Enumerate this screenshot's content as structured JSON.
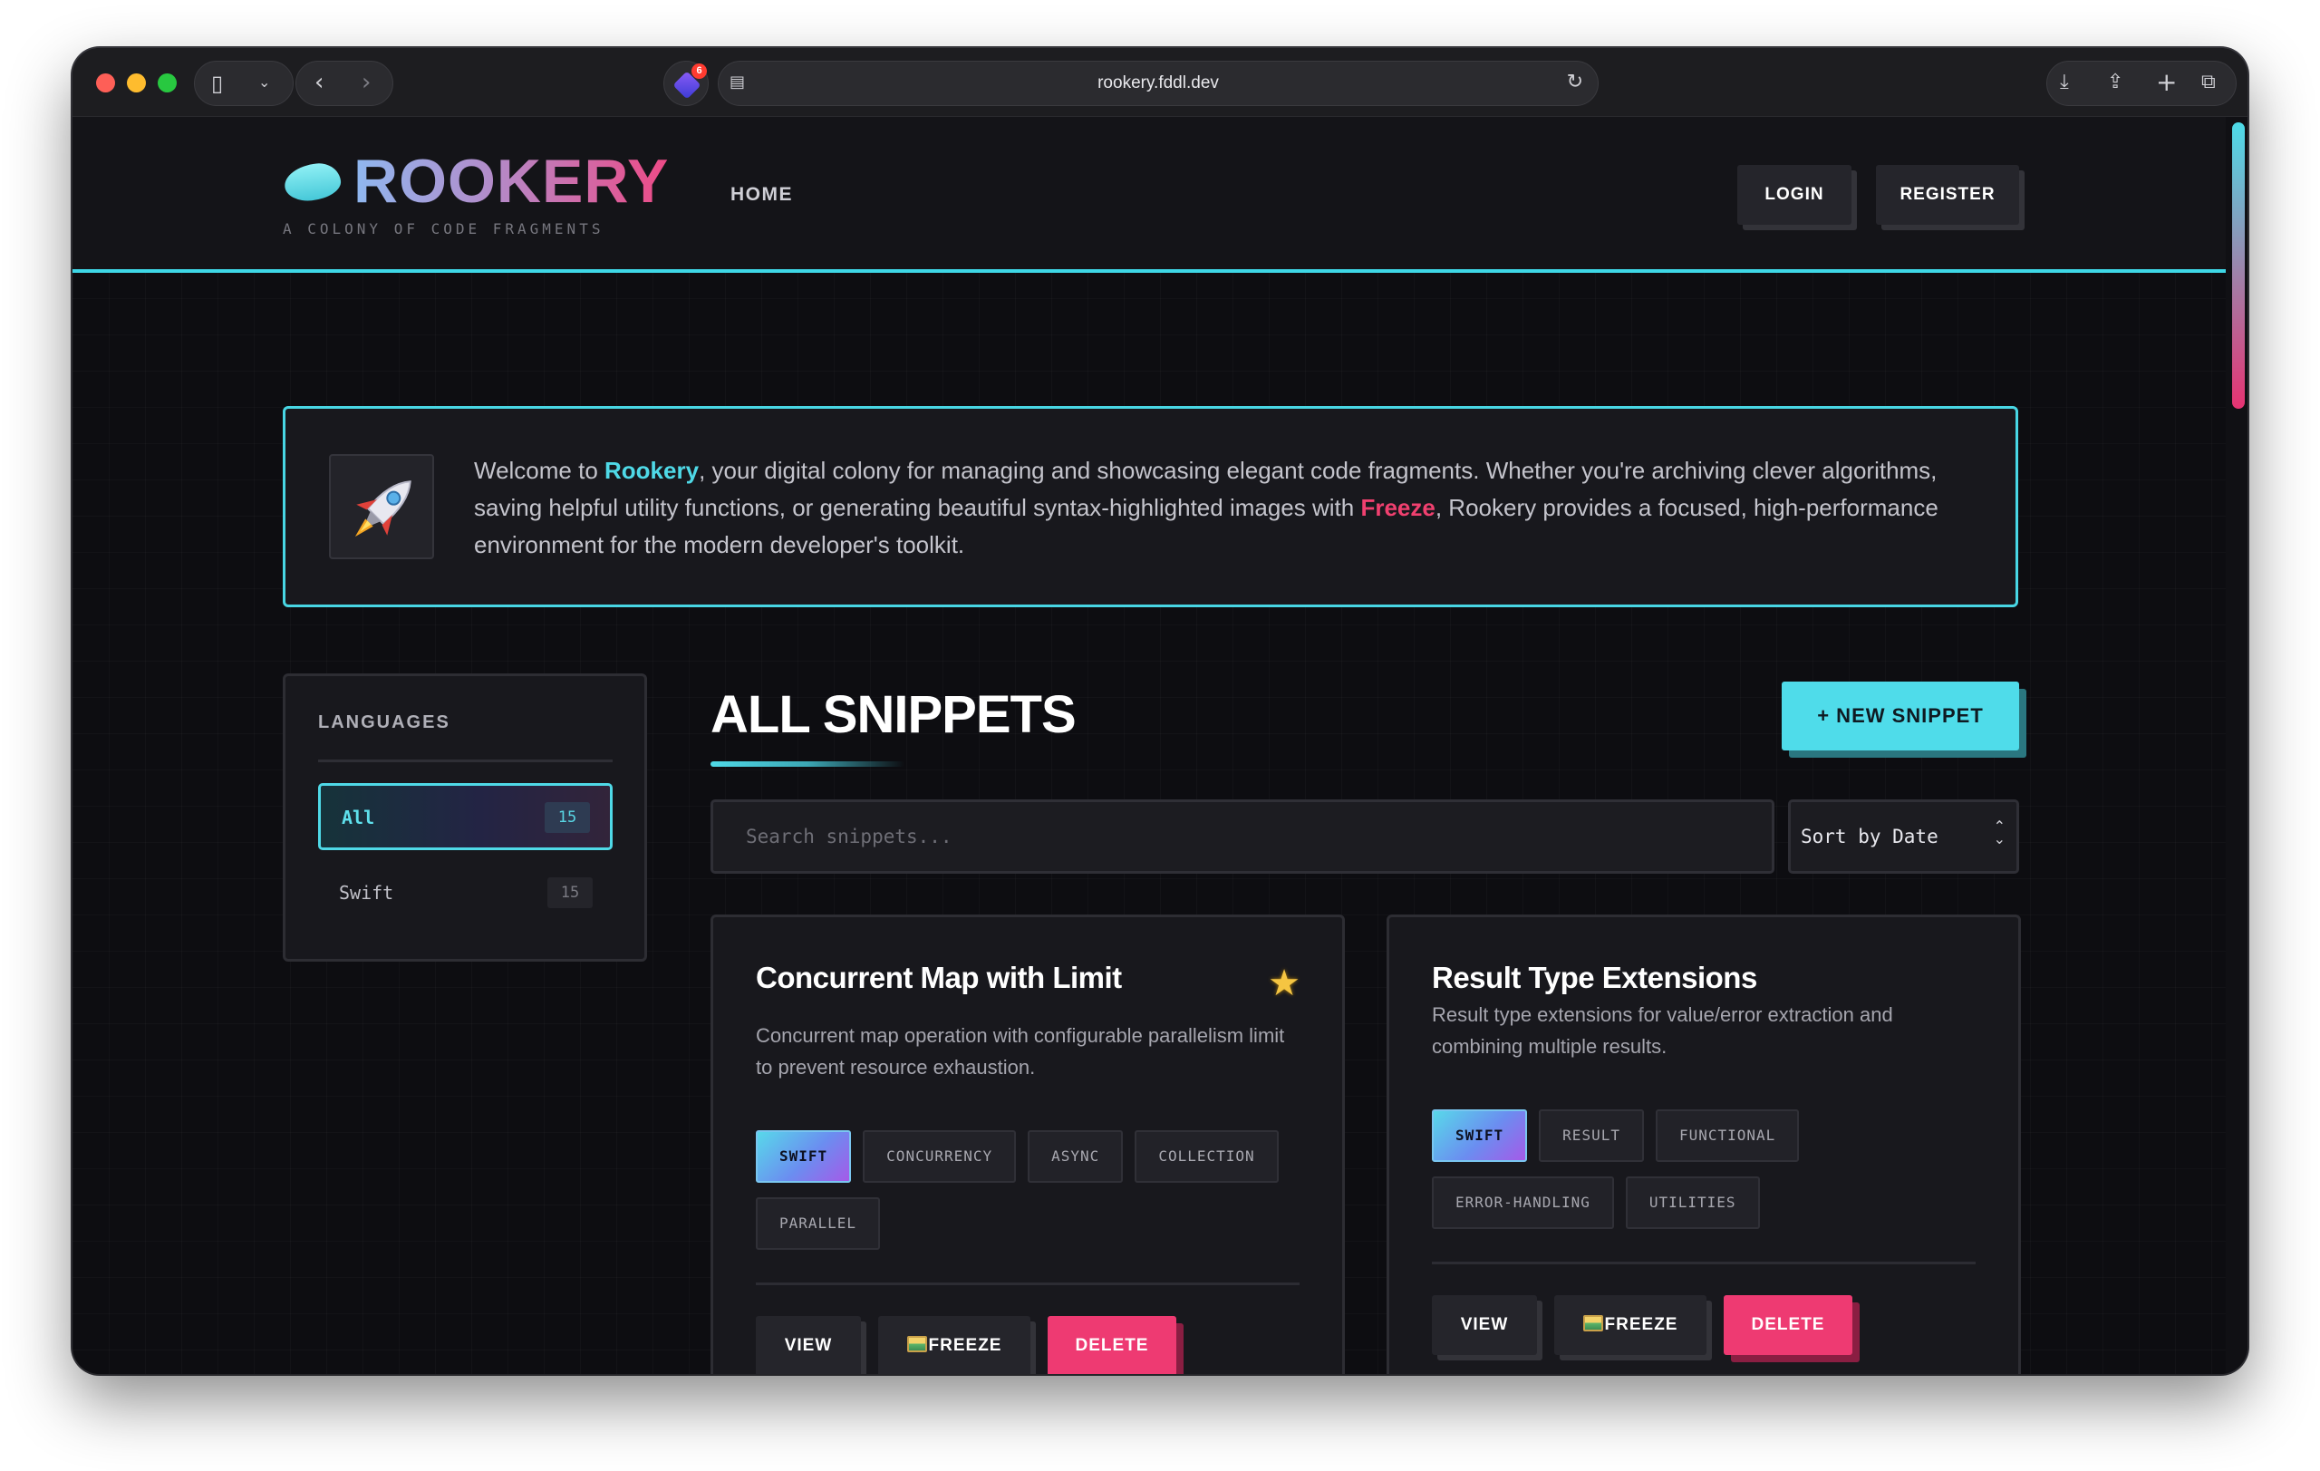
{
  "browser": {
    "url": "rookery.fddl.dev",
    "extension_badge_count": "6"
  },
  "header": {
    "logo_text": "ROOKERY",
    "tagline": "A COLONY OF CODE FRAGMENTS",
    "nav_home": "HOME",
    "login_label": "LOGIN",
    "register_label": "REGISTER"
  },
  "banner": {
    "icon": "rocket-icon",
    "text_1": "Welcome to ",
    "brand": "Rookery",
    "text_2": ", your digital colony for managing and showcasing elegant code fragments. Whether you're archiving clever algorithms, saving helpful utility functions, or generating beautiful syntax-highlighted images with ",
    "freeze": "Freeze",
    "text_3": ", Rookery provides a focused, high-performance environment for the modern developer's toolkit."
  },
  "sidebar": {
    "title": "LANGUAGES",
    "items": [
      {
        "label": "All",
        "count": "15",
        "active": true
      },
      {
        "label": "Swift",
        "count": "15",
        "active": false
      }
    ]
  },
  "main": {
    "title": "ALL SNIPPETS",
    "new_button": "+ NEW SNIPPET",
    "search_placeholder": "Search snippets...",
    "sort_label": "Sort by Date"
  },
  "cards": [
    {
      "title": "Concurrent Map with Limit",
      "starred": true,
      "description": "Concurrent map operation with configurable parallelism limit to prevent resource exhaustion.",
      "tags": [
        "SWIFT",
        "CONCURRENCY",
        "ASYNC",
        "COLLECTION",
        "PARALLEL"
      ],
      "view_label": "VIEW",
      "freeze_label": "FREEZE",
      "delete_label": "DELETE"
    },
    {
      "title": "Result Type Extensions",
      "starred": false,
      "description": "Result type extensions for value/error extraction and combining multiple results.",
      "tags": [
        "SWIFT",
        "RESULT",
        "FUNCTIONAL",
        "ERROR-HANDLING",
        "UTILITIES"
      ],
      "view_label": "VIEW",
      "freeze_label": "FREEZE",
      "delete_label": "DELETE"
    }
  ],
  "colors": {
    "accent_cyan": "#4fd9e7",
    "accent_pink": "#ee3a72",
    "background": "#0d0d11"
  }
}
